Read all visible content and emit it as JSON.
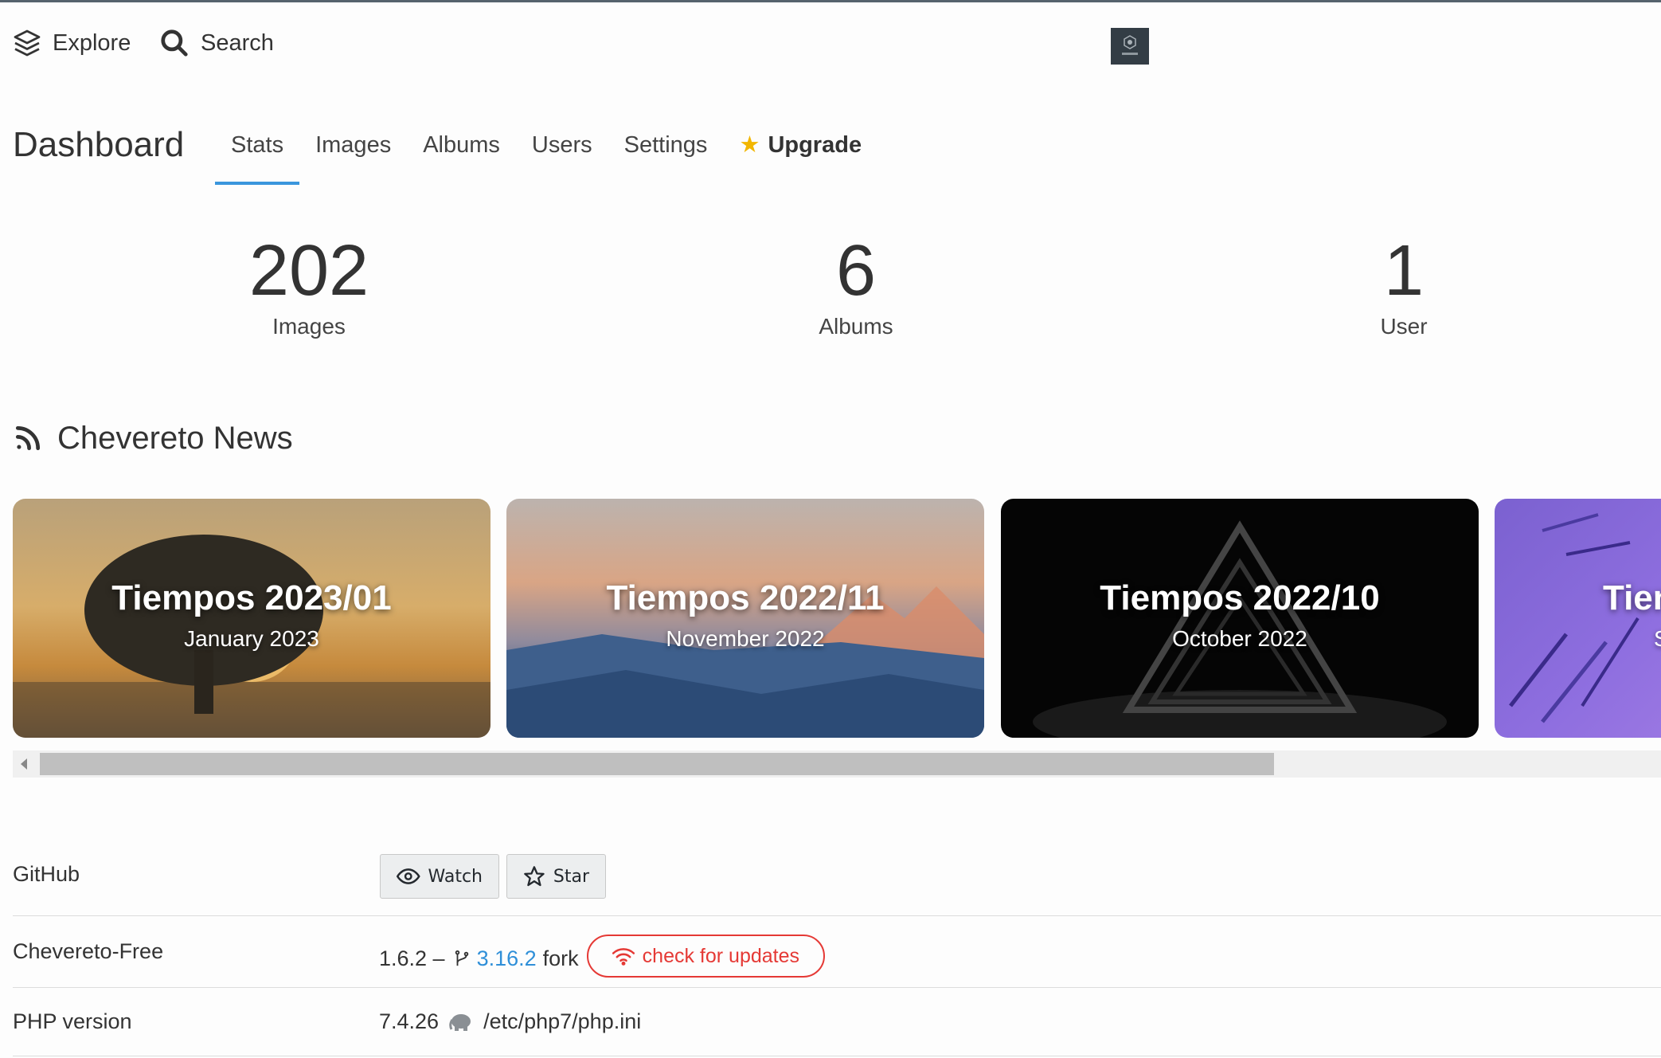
{
  "topbar": {
    "explore_label": "Explore",
    "search_label": "Search"
  },
  "dashboard": {
    "title": "Dashboard",
    "tabs": [
      {
        "label": "Stats",
        "active": true
      },
      {
        "label": "Images"
      },
      {
        "label": "Albums"
      },
      {
        "label": "Users"
      },
      {
        "label": "Settings"
      },
      {
        "label": "Upgrade",
        "icon": "star-icon"
      }
    ]
  },
  "stats": [
    {
      "value": "202",
      "label": "Images"
    },
    {
      "value": "6",
      "label": "Albums"
    },
    {
      "value": "1",
      "label": "User"
    }
  ],
  "news": {
    "title": "Chevereto News",
    "cards": [
      {
        "title": "Tiempos 2023/01",
        "subtitle": "January 2023"
      },
      {
        "title": "Tiempos 2022/11",
        "subtitle": "November 2022"
      },
      {
        "title": "Tiempos 2022/10",
        "subtitle": "October 2022"
      },
      {
        "title": "Tiem",
        "subtitle": "S"
      }
    ]
  },
  "info": {
    "github_label": "GitHub",
    "watch_label": "Watch",
    "star_label": "Star",
    "chevereto_label": "Chevereto-Free",
    "chevereto_version": "1.6.2 –",
    "fork_version": "3.16.2",
    "fork_word": "fork",
    "update_label": "check for updates",
    "php_label": "PHP version",
    "php_version": "7.4.26",
    "php_ini": "/etc/php7/php.ini"
  },
  "colors": {
    "accent": "#3a96dd",
    "star": "#f2b600",
    "update": "#e53935"
  }
}
